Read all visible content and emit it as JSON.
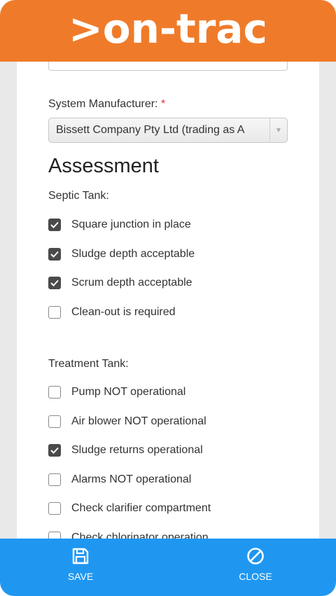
{
  "header": {
    "logo_text": ">on-trac"
  },
  "form": {
    "system_manufacturer": {
      "label": "System Manufacturer:",
      "required_mark": "*",
      "value": "Bissett Company Pty Ltd (trading as A"
    }
  },
  "assessment": {
    "title": "Assessment",
    "septic_tank": {
      "label": "Septic Tank:",
      "items": [
        {
          "label": "Square junction in place",
          "checked": true
        },
        {
          "label": "Sludge depth acceptable",
          "checked": true
        },
        {
          "label": "Scrum depth acceptable",
          "checked": true
        },
        {
          "label": "Clean-out is required",
          "checked": false
        }
      ]
    },
    "treatment_tank": {
      "label": "Treatment Tank:",
      "items": [
        {
          "label": "Pump NOT operational",
          "checked": false
        },
        {
          "label": "Air blower NOT operational",
          "checked": false
        },
        {
          "label": "Sludge returns operational",
          "checked": true
        },
        {
          "label": "Alarms NOT operational",
          "checked": false
        },
        {
          "label": "Check clarifier compartment",
          "checked": false
        },
        {
          "label": "Check chlorinator operation",
          "checked": false
        }
      ]
    }
  },
  "footer": {
    "save_label": "SAVE",
    "close_label": "CLOSE",
    "save_icon": "save-icon",
    "close_icon": "close-icon"
  },
  "colors": {
    "header": "#ef7b2a",
    "footer": "#1f97f1",
    "required": "#d9363e"
  }
}
